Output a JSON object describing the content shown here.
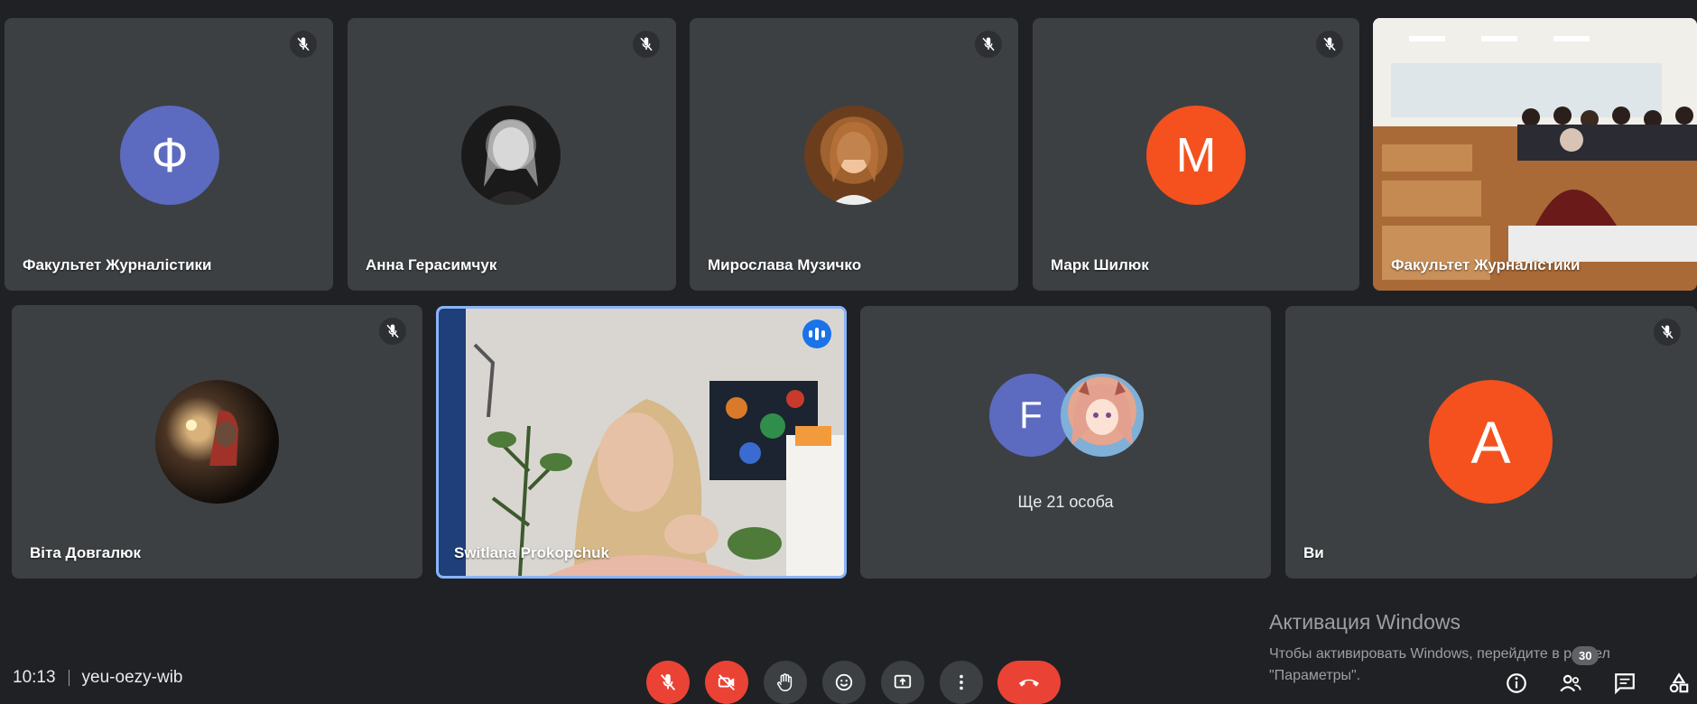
{
  "meeting": {
    "time": "10:13",
    "code": "yeu-oezy-wib",
    "participant_count": "30"
  },
  "tiles": {
    "t1": {
      "name": "Факультет Журналістики",
      "avatar_letter": "Ф",
      "avatar_color": "#5c6bc0"
    },
    "t2": {
      "name": "Анна Герасимчук"
    },
    "t3": {
      "name": "Мирослава Музичко"
    },
    "t4": {
      "name": "Марк Шилюк",
      "avatar_letter": "M",
      "avatar_color": "#f4511e"
    },
    "t5": {
      "name": "Факультет Журналістики"
    },
    "t6": {
      "name": "Віта Довгалюк"
    },
    "t7": {
      "name": "Switlana Prokopchuk"
    },
    "t8": {
      "avatar_letter": "F",
      "avatar_color": "#5c6bc0",
      "more_label": "Ще 21 особа"
    },
    "t9": {
      "name": "Ви",
      "avatar_letter": "A",
      "avatar_color": "#f4511e"
    }
  },
  "activation": {
    "title": "Активация Windows",
    "line1": "Чтобы активировать Windows, перейдите в раздел",
    "line2": "\"Параметры\"."
  },
  "icons": {
    "mute": "mic-off-icon",
    "speaking": "audio-level-icon",
    "controls": [
      "mic-off-icon",
      "camera-off-icon",
      "raise-hand-icon",
      "emoji-icon",
      "present-icon",
      "more-options-icon",
      "end-call-icon"
    ],
    "right": [
      "info-icon",
      "people-icon",
      "chat-icon",
      "activities-icon"
    ]
  },
  "colors": {
    "background": "#202124",
    "tile": "#3c4043",
    "danger": "#ea4335",
    "accent": "#1a73e8"
  }
}
